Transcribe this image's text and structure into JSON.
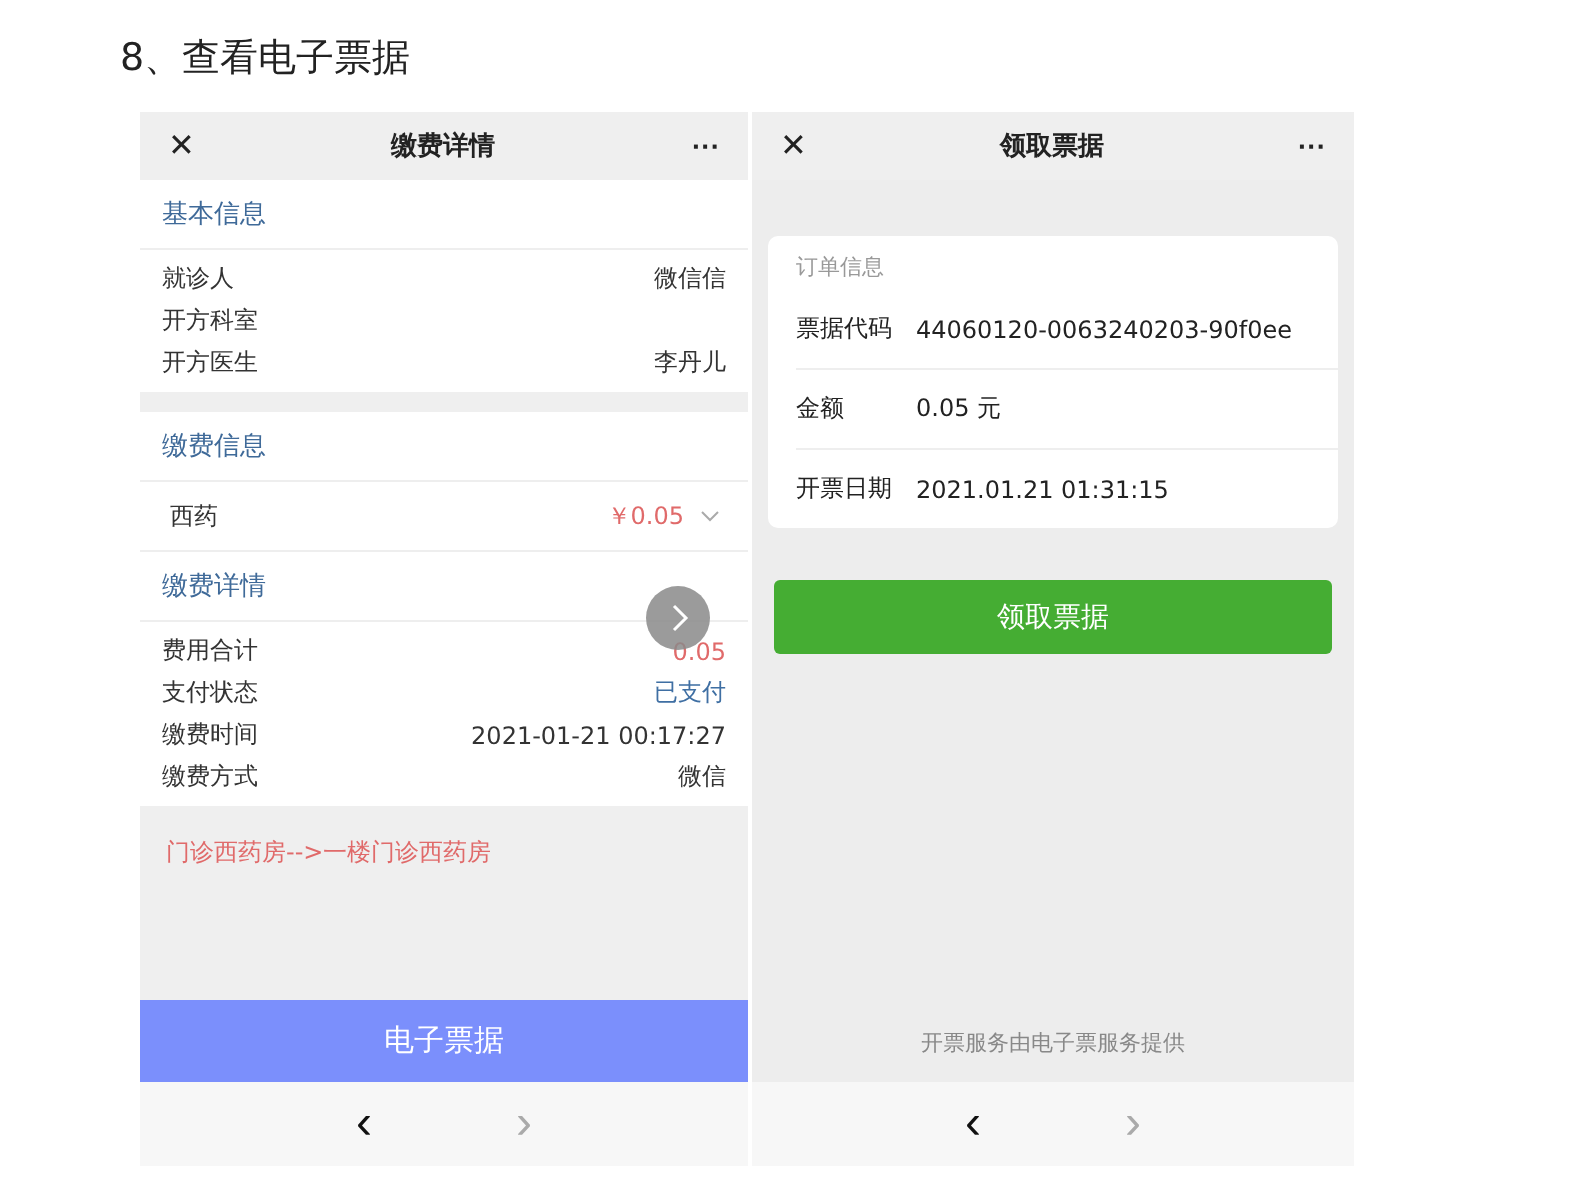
{
  "heading": "8、查看电子票据",
  "left_screen": {
    "title": "缴费详情",
    "close": "✕",
    "more": "···",
    "basic_info": {
      "title": "基本信息",
      "rows": [
        {
          "label": "就诊人",
          "value": "微信信"
        },
        {
          "label": "开方科室"
        },
        {
          "label": "开方医生",
          "value": "李丹儿"
        }
      ]
    },
    "payment_info": {
      "title": "缴费信息",
      "item": {
        "label": "西药",
        "amount": "￥0.05",
        "expanded": false
      }
    },
    "payment_details": {
      "title": "缴费详情",
      "rows": [
        {
          "label": "费用合计",
          "value": "0.05",
          "color": "#e06a6a"
        },
        {
          "label": "支付状态",
          "value": "已支付",
          "color": "#3f6fa3"
        },
        {
          "label": "缴费时间",
          "value": "2021-01-21 00:17:27",
          "color": "#333333"
        },
        {
          "label": "缴费方式",
          "value": "微信",
          "color": "#333333"
        }
      ]
    },
    "pharmacy_route": "门诊西药房-->一楼门诊西药房",
    "button": "电子票据",
    "nav": [
      {
        "glyph": "‹",
        "disabled": false
      },
      {
        "glyph": "›",
        "disabled": true
      }
    ]
  },
  "right_screen": {
    "title": "领取票据",
    "close": "✕",
    "more": "···",
    "card": {
      "title": "订单信息",
      "rows": [
        {
          "label": "票据代码",
          "value": "44060120-0063240203-90f0ee"
        },
        {
          "label": "金额",
          "value": "0.05 元"
        },
        {
          "label": "开票日期",
          "value": "2021.01.21 01:31:15"
        }
      ]
    },
    "button": "领取票据",
    "footer": "开票服务由电子票服务提供",
    "nav": [
      {
        "glyph": "‹",
        "disabled": false
      },
      {
        "glyph": "›",
        "disabled": true
      }
    ]
  }
}
